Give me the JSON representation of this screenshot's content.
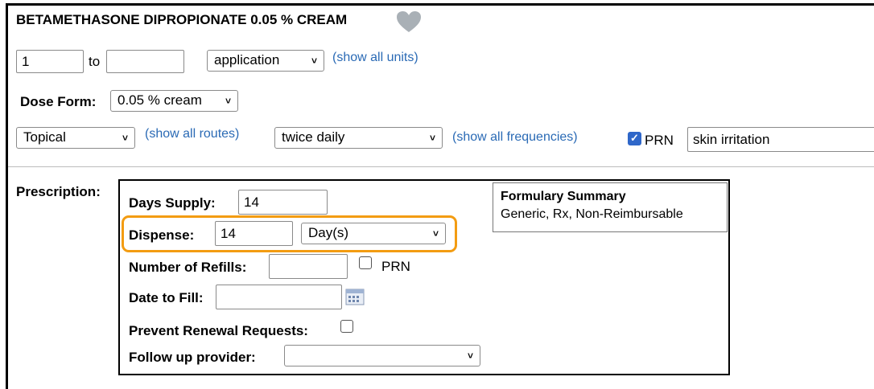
{
  "drug": {
    "name": "BETAMETHASONE DIPROPIONATE 0.05 % CREAM"
  },
  "dose": {
    "from_value": "1",
    "to_label": "to",
    "to_value": "",
    "unit_selected": "application",
    "show_units_link": "(show all units)"
  },
  "dose_form": {
    "label": "Dose Form:",
    "selected": "0.05 % cream"
  },
  "route": {
    "selected": "Topical",
    "show_routes_link": "(show all routes)"
  },
  "frequency": {
    "selected": "twice daily",
    "show_frequencies_link": "(show all frequencies)"
  },
  "prn": {
    "checked": true,
    "label": "PRN",
    "reason_value": "skin irritation"
  },
  "prescription": {
    "section_label": "Prescription:",
    "days_supply": {
      "label": "Days Supply:",
      "value": "14"
    },
    "dispense": {
      "label": "Dispense:",
      "value": "14",
      "unit_selected": "Day(s)"
    },
    "refills": {
      "label": "Number of Refills:",
      "value": "",
      "prn_label": "PRN",
      "prn_checked": false
    },
    "date_to_fill": {
      "label": "Date to Fill:",
      "value": ""
    },
    "prevent_renewal": {
      "label": "Prevent Renewal Requests:",
      "checked": false
    },
    "follow_up": {
      "label": "Follow up provider:",
      "selected": ""
    },
    "formulary": {
      "title": "Formulary Summary",
      "text": "Generic, Rx, Non-Reimbursable"
    }
  },
  "colors": {
    "link": "#2a6ab5",
    "highlight": "#f39c12",
    "checkbox_checked": "#2f67c9",
    "heart": "#a9b0b6"
  },
  "icons": [
    "heart-icon",
    "chevron-down-icon",
    "calendar-icon",
    "checkmark-icon"
  ]
}
